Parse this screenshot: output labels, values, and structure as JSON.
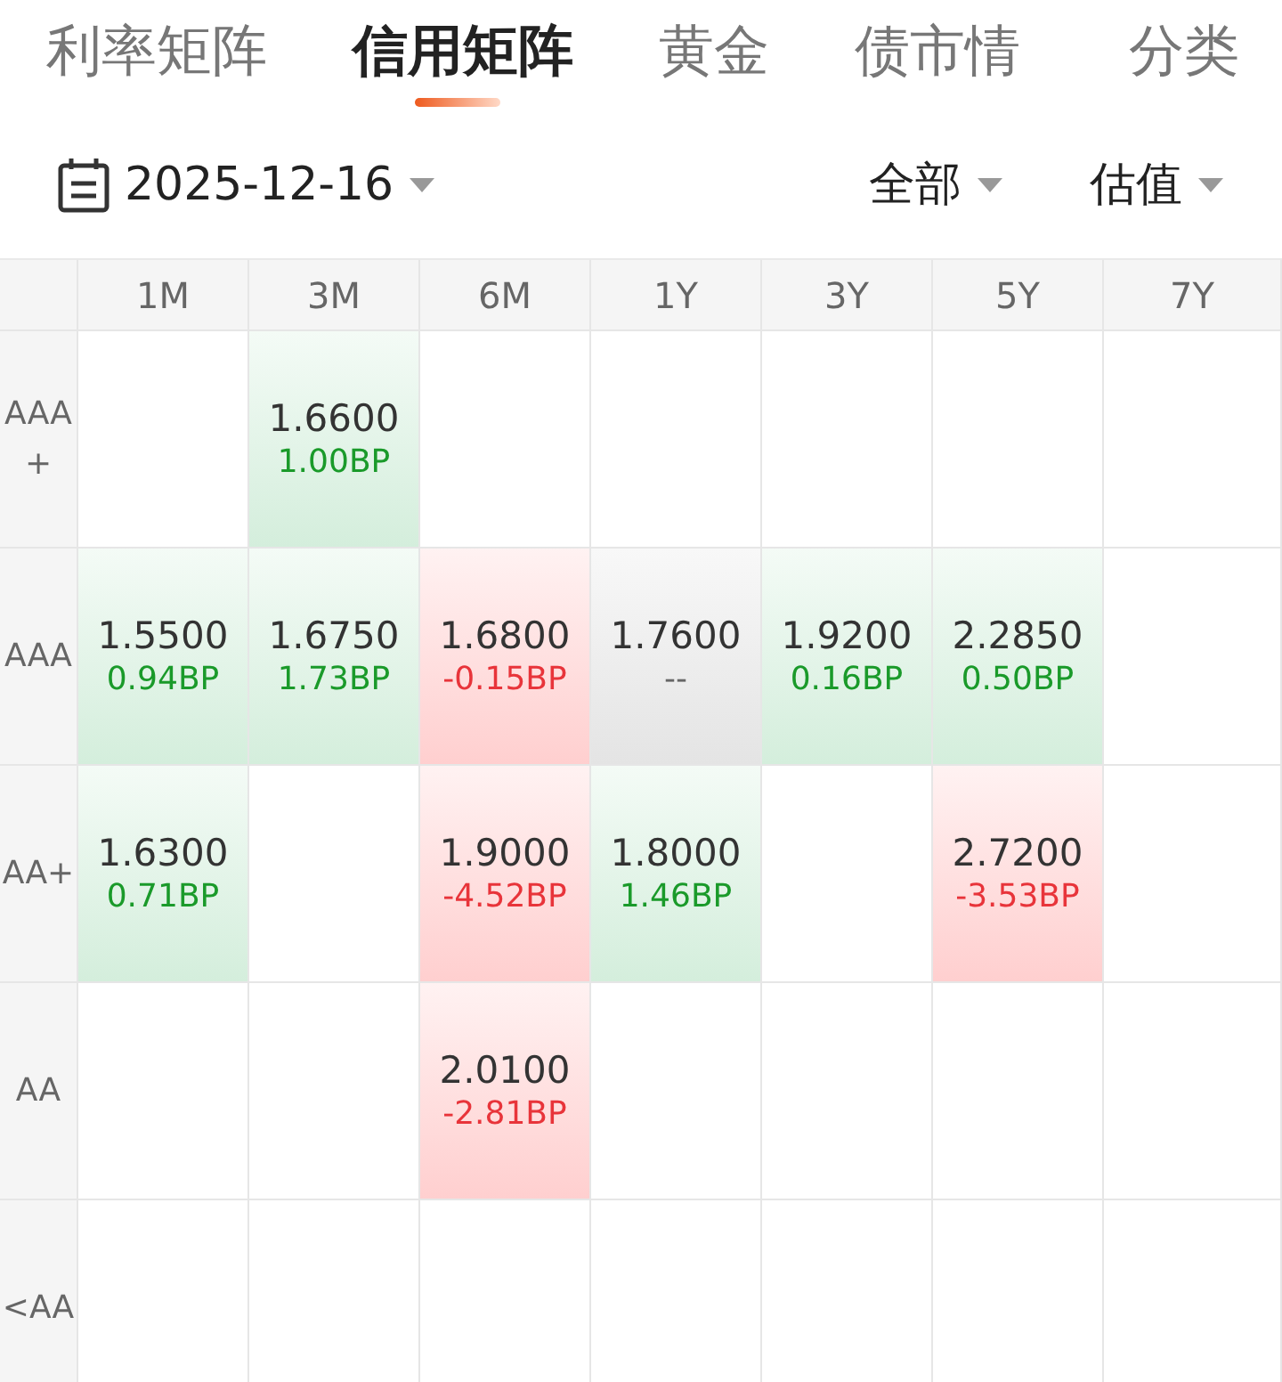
{
  "tabs": [
    {
      "label": "利率矩阵",
      "selected": false
    },
    {
      "label": "信用矩阵",
      "selected": true
    },
    {
      "label": "黄金",
      "selected": false
    },
    {
      "label": "债市情",
      "selected": false
    }
  ],
  "category_button": "分类",
  "filters": {
    "date": "2025-12-16",
    "scope": "全部",
    "measure": "估值"
  },
  "table": {
    "columns": [
      "1M",
      "3M",
      "6M",
      "1Y",
      "3Y",
      "5Y",
      "7Y"
    ],
    "rows": [
      {
        "rating": "AAA+",
        "cells": [
          {
            "kind": "empty"
          },
          {
            "kind": "up",
            "value": "1.6600",
            "change": "1.00BP"
          },
          {
            "kind": "empty"
          },
          {
            "kind": "empty"
          },
          {
            "kind": "empty"
          },
          {
            "kind": "empty"
          },
          {
            "kind": "empty"
          }
        ]
      },
      {
        "rating": "AAA",
        "cells": [
          {
            "kind": "up",
            "value": "1.5500",
            "change": "0.94BP"
          },
          {
            "kind": "up",
            "value": "1.6750",
            "change": "1.73BP"
          },
          {
            "kind": "down",
            "value": "1.6800",
            "change": "-0.15BP"
          },
          {
            "kind": "flat",
            "value": "1.7600",
            "change": "--"
          },
          {
            "kind": "up",
            "value": "1.9200",
            "change": "0.16BP"
          },
          {
            "kind": "up",
            "value": "2.2850",
            "change": "0.50BP"
          },
          {
            "kind": "empty"
          }
        ]
      },
      {
        "rating": "AA+",
        "cells": [
          {
            "kind": "up",
            "value": "1.6300",
            "change": "0.71BP"
          },
          {
            "kind": "empty"
          },
          {
            "kind": "down",
            "value": "1.9000",
            "change": "-4.52BP"
          },
          {
            "kind": "up",
            "value": "1.8000",
            "change": "1.46BP"
          },
          {
            "kind": "empty"
          },
          {
            "kind": "down",
            "value": "2.7200",
            "change": "-3.53BP"
          },
          {
            "kind": "empty"
          }
        ]
      },
      {
        "rating": "AA",
        "cells": [
          {
            "kind": "empty"
          },
          {
            "kind": "empty"
          },
          {
            "kind": "down",
            "value": "2.0100",
            "change": "-2.81BP"
          },
          {
            "kind": "empty"
          },
          {
            "kind": "empty"
          },
          {
            "kind": "empty"
          },
          {
            "kind": "empty"
          }
        ]
      },
      {
        "rating": "<AA",
        "cells": [
          {
            "kind": "empty"
          },
          {
            "kind": "empty"
          },
          {
            "kind": "empty"
          },
          {
            "kind": "empty"
          },
          {
            "kind": "empty"
          },
          {
            "kind": "empty"
          },
          {
            "kind": "empty"
          }
        ]
      }
    ]
  }
}
